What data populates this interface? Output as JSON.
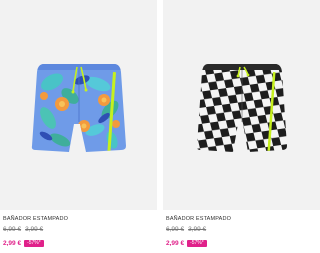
{
  "products": [
    {
      "name": "BAÑADOR ESTAMPADO",
      "original_prices": [
        "6,99 €",
        "3,99 €"
      ],
      "sale_price": "2,99 €",
      "discount_badge": "-57%*",
      "image": "tropical-print-swim-shorts"
    },
    {
      "name": "BAÑADOR ESTAMPADO",
      "original_prices": [
        "6,99 €",
        "3,99 €"
      ],
      "sale_price": "2,99 €",
      "discount_badge": "-57%*",
      "image": "checkered-print-swim-shorts"
    }
  ],
  "colors": {
    "sale": "#e0218a",
    "card_bg": "#f2f2f2",
    "drawstring": "#c6f01e"
  }
}
